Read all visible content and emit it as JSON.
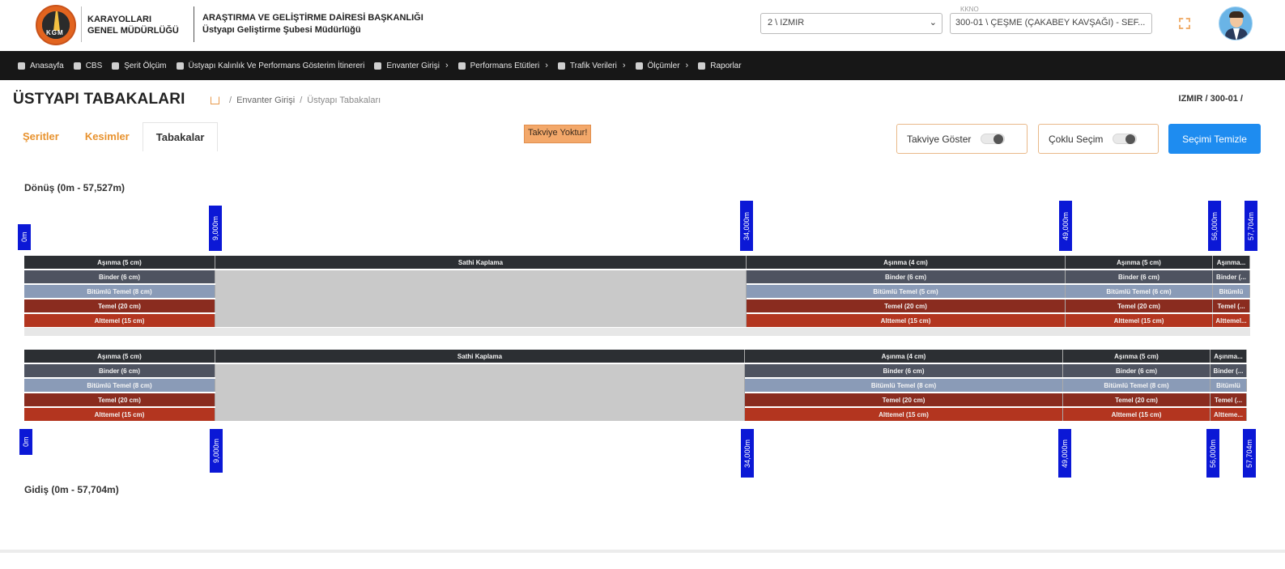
{
  "header": {
    "org_line1": "KARAYOLLARI",
    "org_line2": "GENEL MÜDÜRLÜĞÜ",
    "logo_text": "KGM",
    "dept_line1": "ARAŞTIRMA VE GELİŞTİRME DAİRESİ BAŞKANLIĞI",
    "dept_line2": "Üstyapı Geliştirme Şubesi Müdürlüğü",
    "region_value": "2 \\ IZMIR",
    "kkno_label": "KKNO",
    "kkno_value": "300-01 \\ ÇEŞME (ÇAKABEY KAVŞAĞI) - SEF..."
  },
  "nav": {
    "items": [
      {
        "label": "Anasayfa",
        "icon": "home-icon",
        "has_submenu": false
      },
      {
        "label": "CBS",
        "icon": "map-icon",
        "has_submenu": false
      },
      {
        "label": "Şerit Ölçüm",
        "icon": "layers-icon",
        "has_submenu": false
      },
      {
        "label": "Üstyapı Kalınlık Ve Performans Gösterim İtinereri",
        "icon": "layers-icon",
        "has_submenu": false
      },
      {
        "label": "Envanter Girişi",
        "icon": "layers-icon",
        "has_submenu": true
      },
      {
        "label": "Performans Etütleri",
        "icon": "users-icon",
        "has_submenu": true
      },
      {
        "label": "Trafik Verileri",
        "icon": "users-icon",
        "has_submenu": true
      },
      {
        "label": "Ölçümler",
        "icon": "users-icon",
        "has_submenu": true
      },
      {
        "label": "Raporlar",
        "icon": "users-icon",
        "has_submenu": false
      }
    ]
  },
  "page": {
    "title": "ÜSTYAPI TABAKALARI",
    "breadcrumb": [
      "Envanter Girişi",
      "Üstyapı Tabakaları"
    ],
    "breadcrumb_sep": "/",
    "context_right": "IZMIR  /  300-01  /"
  },
  "tabs": [
    {
      "label": "Şeritler",
      "active": false
    },
    {
      "label": "Kesimler",
      "active": false
    },
    {
      "label": "Tabakalar",
      "active": true
    }
  ],
  "toolbar": {
    "warning": "Takviye Yoktur!",
    "toggle1_label": "Takviye Göster",
    "toggle2_label": "Çoklu Seçim",
    "clear_label": "Seçimi Temizle"
  },
  "sections": {
    "return_title": "Dönüş (0m - 57,527m)",
    "go_title": "Gidiş (0m - 57,704m)"
  },
  "markers": [
    "0m",
    "9,000m",
    "34,000m",
    "49,000m",
    "56,000m",
    "57,704m"
  ],
  "segments": [
    {
      "name": "seg-1",
      "layers": [
        "Aşınma (5 cm)",
        "Binder (6 cm)",
        "Bitümlü Temel (8 cm)",
        "Temel (20 cm)",
        "Alttemel (15 cm)"
      ]
    },
    {
      "name": "seg-2",
      "layers": [
        "Sathi Kaplama",
        "",
        "",
        "",
        ""
      ]
    },
    {
      "name": "seg-3",
      "layers": [
        "Aşınma (4 cm)",
        "Binder (6 cm)",
        "Bitümlü Temel (5 cm)",
        "Temel (20 cm)",
        "Alttemel (15 cm)"
      ]
    },
    {
      "name": "seg-4",
      "layers": [
        "Aşınma (5 cm)",
        "Binder (6 cm)",
        "Bitümlü Temel (6 cm)",
        "Temel (20 cm)",
        "Alttemel (15 cm)"
      ]
    },
    {
      "name": "seg-5",
      "layers": [
        "Aşınma...",
        "Binder (...",
        "Bitümlü",
        "Temel (...",
        "Alttemel..."
      ]
    }
  ],
  "segments_go": [
    {
      "name": "seg-1",
      "layers": [
        "Aşınma (5 cm)",
        "Binder (6 cm)",
        "Bitümlü Temel (8 cm)",
        "Temel (20 cm)",
        "Alttemel (15 cm)"
      ]
    },
    {
      "name": "seg-2",
      "layers": [
        "Sathi Kaplama",
        "",
        "",
        "",
        ""
      ]
    },
    {
      "name": "seg-3",
      "layers": [
        "Aşınma (4 cm)",
        "Binder (6 cm)",
        "Bitümlü Temel (8 cm)",
        "Temel (20 cm)",
        "Alttemel (15 cm)"
      ]
    },
    {
      "name": "seg-4",
      "layers": [
        "Aşınma (5 cm)",
        "Binder (6 cm)",
        "Bitümlü Temel (8 cm)",
        "Temel (20 cm)",
        "Alttemel (15 cm)"
      ]
    },
    {
      "name": "seg-5",
      "layers": [
        "Aşınma...",
        "Binder (...",
        "Bitümlü",
        "Temel (...",
        "Altteme..."
      ]
    }
  ],
  "colors": {
    "nav_bg": "#171717",
    "accent_orange": "#e8922e",
    "primary_blue": "#1e8cf0",
    "marker_blue": "#0b18d6",
    "warning_bg": "#f3a86a"
  }
}
